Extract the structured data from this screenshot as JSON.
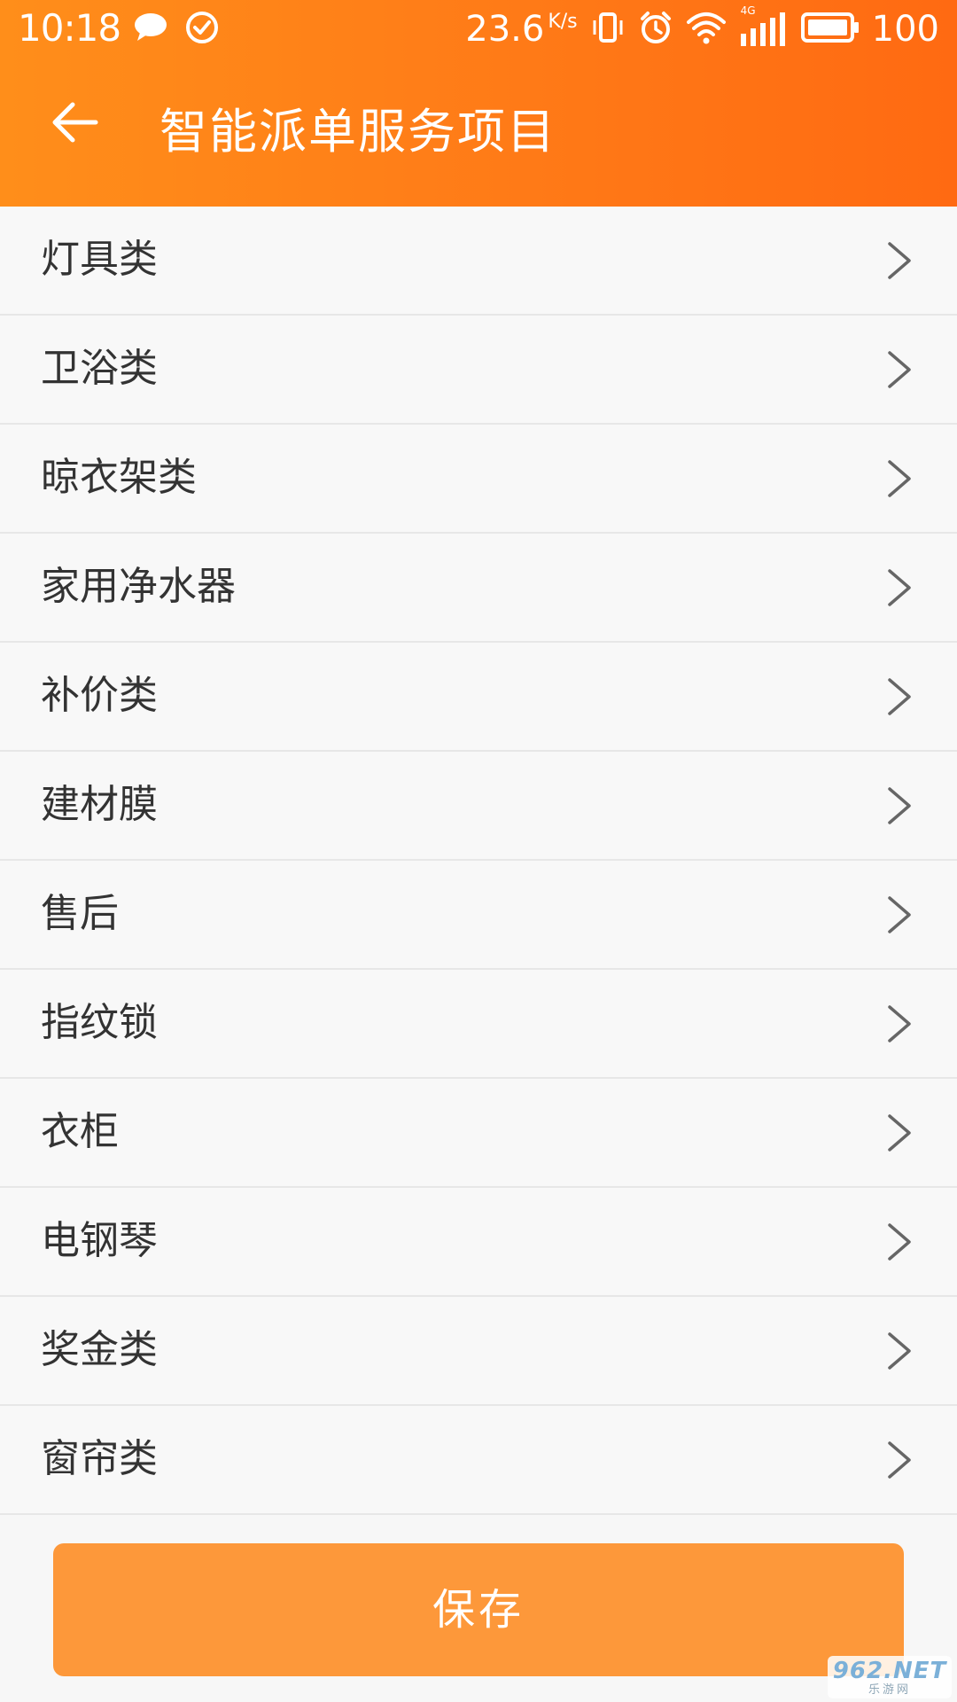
{
  "status_bar": {
    "time": "10:18",
    "speed_value": "23.6",
    "speed_unit": "K/s",
    "network_type": "4G",
    "battery": "100",
    "icons": [
      "message-icon",
      "check-circle-icon",
      "vibrate-icon",
      "alarm-icon",
      "wifi-icon",
      "signal-icon",
      "battery-icon"
    ]
  },
  "header": {
    "title": "智能派单服务项目",
    "back_icon": "arrow-left-icon",
    "gradient_start": "#ff8e1a",
    "gradient_end": "#ff6a12"
  },
  "list": {
    "items": [
      {
        "label": "灯具类"
      },
      {
        "label": "卫浴类"
      },
      {
        "label": "晾衣架类"
      },
      {
        "label": "家用净水器"
      },
      {
        "label": "补价类"
      },
      {
        "label": "建材膜"
      },
      {
        "label": "售后"
      },
      {
        "label": "指纹锁"
      },
      {
        "label": "衣柜"
      },
      {
        "label": "电钢琴"
      },
      {
        "label": "奖金类"
      },
      {
        "label": "窗帘类"
      }
    ],
    "chevron_icon": "chevron-right-icon"
  },
  "footer": {
    "save_label": "保存",
    "save_color": "#fd983a"
  },
  "watermark": {
    "main": "962.NET",
    "sub": "乐游网"
  }
}
